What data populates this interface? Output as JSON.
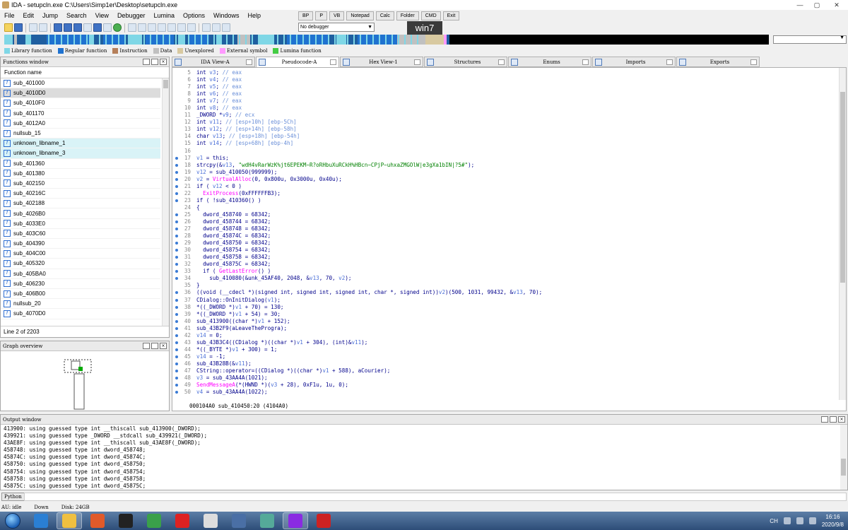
{
  "window": {
    "title": "IDA - setupcln.exe C:\\Users\\Simp1er\\Desktop\\setupcln.exe",
    "controls": [
      "—",
      "▢",
      "✕"
    ]
  },
  "menu": [
    "File",
    "Edit",
    "Jump",
    "Search",
    "View",
    "Debugger",
    "Lumina",
    "Options",
    "Windows",
    "Help"
  ],
  "quick_buttons": [
    "BP",
    "P",
    "VB",
    "Notepad",
    "Calc",
    "Folder",
    "CMD",
    "Exit"
  ],
  "debugger_select": "No debugger",
  "overlay_label": "win7",
  "legend": [
    {
      "label": "Library function",
      "color": "#7fd7e6"
    },
    {
      "label": "Regular function",
      "color": "#1f72d0"
    },
    {
      "label": "Instruction",
      "color": "#b57f5a"
    },
    {
      "label": "Data",
      "color": "#c0c0c0"
    },
    {
      "label": "Unexplored",
      "color": "#d8c9a0"
    },
    {
      "label": "External symbol",
      "color": "#ff99ff"
    },
    {
      "label": "Lumina function",
      "color": "#44cc44"
    }
  ],
  "functions_pane": {
    "title": "Functions window",
    "column": "Function name",
    "status": "Line 2 of 2203",
    "items": [
      {
        "name": "sub_401000",
        "kind": "normal"
      },
      {
        "name": "sub_4010D0",
        "kind": "selected"
      },
      {
        "name": "sub_4010F0",
        "kind": "normal"
      },
      {
        "name": "sub_401170",
        "kind": "normal"
      },
      {
        "name": "sub_4012A0",
        "kind": "normal"
      },
      {
        "name": "nullsub_15",
        "kind": "normal"
      },
      {
        "name": "unknown_libname_1",
        "kind": "lib"
      },
      {
        "name": "unknown_libname_3",
        "kind": "lib"
      },
      {
        "name": "sub_401360",
        "kind": "normal"
      },
      {
        "name": "sub_401380",
        "kind": "normal"
      },
      {
        "name": "sub_402150",
        "kind": "normal"
      },
      {
        "name": "sub_40216C",
        "kind": "normal"
      },
      {
        "name": "sub_402188",
        "kind": "normal"
      },
      {
        "name": "sub_4026B0",
        "kind": "normal"
      },
      {
        "name": "sub_4033E0",
        "kind": "normal"
      },
      {
        "name": "sub_403C60",
        "kind": "normal"
      },
      {
        "name": "sub_404390",
        "kind": "normal"
      },
      {
        "name": "sub_404C00",
        "kind": "normal"
      },
      {
        "name": "sub_405320",
        "kind": "normal"
      },
      {
        "name": "sub_405BA0",
        "kind": "normal"
      },
      {
        "name": "sub_406230",
        "kind": "normal"
      },
      {
        "name": "sub_406B00",
        "kind": "normal"
      },
      {
        "name": "nullsub_20",
        "kind": "normal"
      },
      {
        "name": "sub_4070D0",
        "kind": "normal"
      }
    ]
  },
  "graph_pane": {
    "title": "Graph overview"
  },
  "tabs": [
    {
      "label": "IDA View-A",
      "active": false
    },
    {
      "label": "Pseudocode-A",
      "active": true
    },
    {
      "label": "Hex View-1",
      "active": false
    },
    {
      "label": "Structures",
      "active": false
    },
    {
      "label": "Enums",
      "active": false
    },
    {
      "label": "Imports",
      "active": false
    },
    {
      "label": "Exports",
      "active": false
    }
  ],
  "code": {
    "status": "000104A0 sub_410450:20 (4104A0)",
    "lines": [
      {
        "n": "5",
        "dot": false,
        "text": "int v3; // eax"
      },
      {
        "n": "6",
        "dot": false,
        "text": "int v4; // eax"
      },
      {
        "n": "7",
        "dot": false,
        "text": "int v5; // eax"
      },
      {
        "n": "8",
        "dot": false,
        "text": "int v6; // eax"
      },
      {
        "n": "9",
        "dot": false,
        "text": "int v7; // eax"
      },
      {
        "n": "10",
        "dot": false,
        "text": "int v8; // eax"
      },
      {
        "n": "11",
        "dot": false,
        "text": "_DWORD *v9; // ecx"
      },
      {
        "n": "12",
        "dot": false,
        "text": "int v11; // [esp+10h] [ebp-5Ch]"
      },
      {
        "n": "13",
        "dot": false,
        "text": "int v12; // [esp+14h] [ebp-58h]"
      },
      {
        "n": "14",
        "dot": false,
        "text": "char v13; // [esp+18h] [ebp-54h]"
      },
      {
        "n": "15",
        "dot": false,
        "text": "int v14; // [esp+68h] [ebp-4h]"
      },
      {
        "n": "16",
        "dot": false,
        "text": ""
      },
      {
        "n": "17",
        "dot": true,
        "text": "v1 = this;"
      },
      {
        "n": "18",
        "dot": true,
        "text": "strcpy(&v13, \"wdH4vRarWzK%jt6EPEKM~R?oRHbuXuRCkH%HBcn~CPjP~uhxaZMGOlW|e3gXa1bIN|?5#\");"
      },
      {
        "n": "19",
        "dot": true,
        "text": "v12 = sub_410050(999999);"
      },
      {
        "n": "20",
        "dot": true,
        "text": "v2 = VirtualAlloc(0, 0x800u, 0x3000u, 0x40u);"
      },
      {
        "n": "21",
        "dot": true,
        "text": "if ( v12 < 0 )"
      },
      {
        "n": "22",
        "dot": true,
        "text": "  ExitProcess(0xFFFFFFB3);"
      },
      {
        "n": "23",
        "dot": true,
        "text": "if ( !sub_410360() )"
      },
      {
        "n": "24",
        "dot": false,
        "text": "{"
      },
      {
        "n": "25",
        "dot": true,
        "text": "  dword_458740 = 68342;"
      },
      {
        "n": "26",
        "dot": true,
        "text": "  dword_458744 = 68342;"
      },
      {
        "n": "27",
        "dot": true,
        "text": "  dword_458748 = 68342;"
      },
      {
        "n": "28",
        "dot": true,
        "text": "  dword_45874C = 68342;"
      },
      {
        "n": "29",
        "dot": true,
        "text": "  dword_458750 = 68342;"
      },
      {
        "n": "30",
        "dot": true,
        "text": "  dword_458754 = 68342;"
      },
      {
        "n": "31",
        "dot": true,
        "text": "  dword_458758 = 68342;"
      },
      {
        "n": "32",
        "dot": true,
        "text": "  dword_45875C = 68342;"
      },
      {
        "n": "33",
        "dot": true,
        "text": "  if ( GetLastError() )"
      },
      {
        "n": "34",
        "dot": true,
        "text": "    sub_410080(&unk_45AF40, 2048, &v13, 70, v2);"
      },
      {
        "n": "35",
        "dot": false,
        "text": "}"
      },
      {
        "n": "36",
        "dot": true,
        "text": "((void (__cdecl *)(signed int, signed int, signed int, char *, signed int))v2)(500, 1031, 99432, &v13, 70);"
      },
      {
        "n": "37",
        "dot": true,
        "text": "CDialog::OnInitDialog(v1);"
      },
      {
        "n": "38",
        "dot": true,
        "text": "*((_DWORD *)v1 + 70) = 130;"
      },
      {
        "n": "39",
        "dot": true,
        "text": "*((_DWORD *)v1 + 54) = 30;"
      },
      {
        "n": "40",
        "dot": true,
        "text": "sub_413900((char *)v1 + 152);"
      },
      {
        "n": "41",
        "dot": true,
        "text": "sub_43B2F9(aLeaveTheProgra);"
      },
      {
        "n": "42",
        "dot": true,
        "text": "v14 = 0;"
      },
      {
        "n": "43",
        "dot": true,
        "text": "sub_43B3C4((CDialog *)((char *)v1 + 304), (int)&v11);"
      },
      {
        "n": "44",
        "dot": true,
        "text": "*((_BYTE *)v1 + 300) = 1;"
      },
      {
        "n": "45",
        "dot": true,
        "text": "v14 = -1;"
      },
      {
        "n": "46",
        "dot": true,
        "text": "sub_43B28B(&v11);"
      },
      {
        "n": "47",
        "dot": true,
        "text": "CString::operator=((CDialog *)((char *)v1 + 588), aCourier);"
      },
      {
        "n": "48",
        "dot": true,
        "text": "v3 = sub_43AA4A(1021);"
      },
      {
        "n": "49",
        "dot": true,
        "text": "SendMessageA(*(HWND *)(v3 + 28), 0xF1u, 1u, 0);"
      },
      {
        "n": "50",
        "dot": true,
        "text": "v4 = sub_43AA4A(1022);"
      }
    ]
  },
  "output_pane": {
    "title": "Output window",
    "lines": [
      "413900: using guessed type int __thiscall sub_413900(_DWORD);",
      "439921: using guessed type _DWORD __stdcall sub_439921(_DWORD);",
      "43AE8F: using guessed type int __thiscall sub_43AE8F(_DWORD);",
      "458748: using guessed type int dword_458748;",
      "45874C: using guessed type int dword_45874C;",
      "458750: using guessed type int dword_458750;",
      "458754: using guessed type int dword_458754;",
      "458758: using guessed type int dword_458758;",
      "45875C: using guessed type int dword_45875C;"
    ]
  },
  "command": {
    "lang": "Python"
  },
  "status_bar": {
    "au": "AU:  idle",
    "dir": "Down",
    "disk": "Disk: 24GB"
  },
  "taskbar": {
    "time": "16:16",
    "date": "2020/9/8",
    "lang": "CH",
    "apps": [
      "ie",
      "explorer",
      "media",
      "qq",
      "chrome",
      "app-red",
      "app-photo",
      "app-tools",
      "calc",
      "ida",
      "hex"
    ]
  }
}
